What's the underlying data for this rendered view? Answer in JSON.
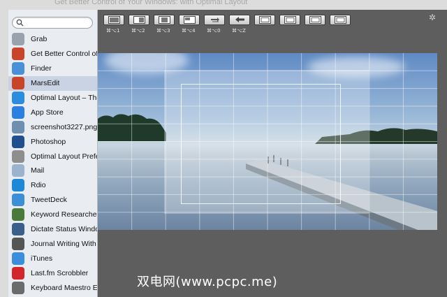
{
  "background_title": "Get Better Control of Your Windows: with Optimal Layout",
  "search": {
    "placeholder": ""
  },
  "apps": [
    {
      "label": "Grab",
      "icon": "grab-icon",
      "color": "#9aa3ad"
    },
    {
      "label": "Get Better Control of",
      "icon": "marsedit-icon",
      "color": "#c8452a"
    },
    {
      "label": "Finder",
      "icon": "finder-icon",
      "color": "#4a90d9"
    },
    {
      "label": "MarsEdit",
      "icon": "marsedit-icon",
      "color": "#c8452a",
      "selected": true
    },
    {
      "label": "Optimal Layout – The",
      "icon": "optimal-layout-icon",
      "color": "#2a8de0"
    },
    {
      "label": "App Store",
      "icon": "app-store-icon",
      "color": "#2a7fe0"
    },
    {
      "label": "screenshot3227.png",
      "icon": "preview-icon",
      "color": "#6f8fb0"
    },
    {
      "label": "Photoshop",
      "icon": "photoshop-icon",
      "color": "#1f4f8f"
    },
    {
      "label": "Optimal Layout Prefe",
      "icon": "layout-prefs-icon",
      "color": "#8e8e8e"
    },
    {
      "label": "Mail",
      "icon": "mail-icon",
      "color": "#9ab4cf"
    },
    {
      "label": "Rdio",
      "icon": "rdio-icon",
      "color": "#1e88d8"
    },
    {
      "label": "TweetDeck",
      "icon": "tweetdeck-icon",
      "color": "#3a8fd6"
    },
    {
      "label": "Keyword Researcher",
      "icon": "keyword-researcher-icon",
      "color": "#4a7a3a"
    },
    {
      "label": "Dictate Status Windo",
      "icon": "dictate-icon",
      "color": "#3a5f8a"
    },
    {
      "label": "Journal Writing With",
      "icon": "journal-icon",
      "color": "#555555"
    },
    {
      "label": "iTunes",
      "icon": "itunes-icon",
      "color": "#3b8ede"
    },
    {
      "label": "Last.fm Scrobbler",
      "icon": "lastfm-icon",
      "color": "#d3252a"
    },
    {
      "label": "Keyboard Maestro Ec",
      "icon": "keyboard-maestro-icon",
      "color": "#6b6b6b"
    }
  ],
  "toolbar": {
    "buttons": [
      {
        "name": "layout-full-button",
        "icon": "full-window-icon",
        "shortcut": "⌘⌥1"
      },
      {
        "name": "layout-right-half-button",
        "icon": "right-half-icon",
        "shortcut": "⌘⌥2"
      },
      {
        "name": "layout-center-button",
        "icon": "center-column-icon",
        "shortcut": "⌘⌥3"
      },
      {
        "name": "layout-top-left-button",
        "icon": "top-left-icon",
        "shortcut": "⌘⌥4"
      },
      {
        "name": "layout-swap-button",
        "icon": "swap-icon",
        "shortcut": "⌘⌥0"
      },
      {
        "name": "layout-undo-button",
        "icon": "undo-arrow-icon",
        "shortcut": "⌘⌥Z"
      },
      {
        "name": "layout-inset-1-button",
        "icon": "inset-window-icon",
        "shortcut": ""
      },
      {
        "name": "layout-inset-2-button",
        "icon": "inset-window-icon",
        "shortcut": ""
      },
      {
        "name": "layout-inset-3-button",
        "icon": "inset-window-icon",
        "shortcut": ""
      },
      {
        "name": "layout-inset-4-button",
        "icon": "inset-window-icon",
        "shortcut": ""
      }
    ]
  },
  "settings_icon": "gear-icon",
  "watermark": "双电网(www.pcpc.me)"
}
